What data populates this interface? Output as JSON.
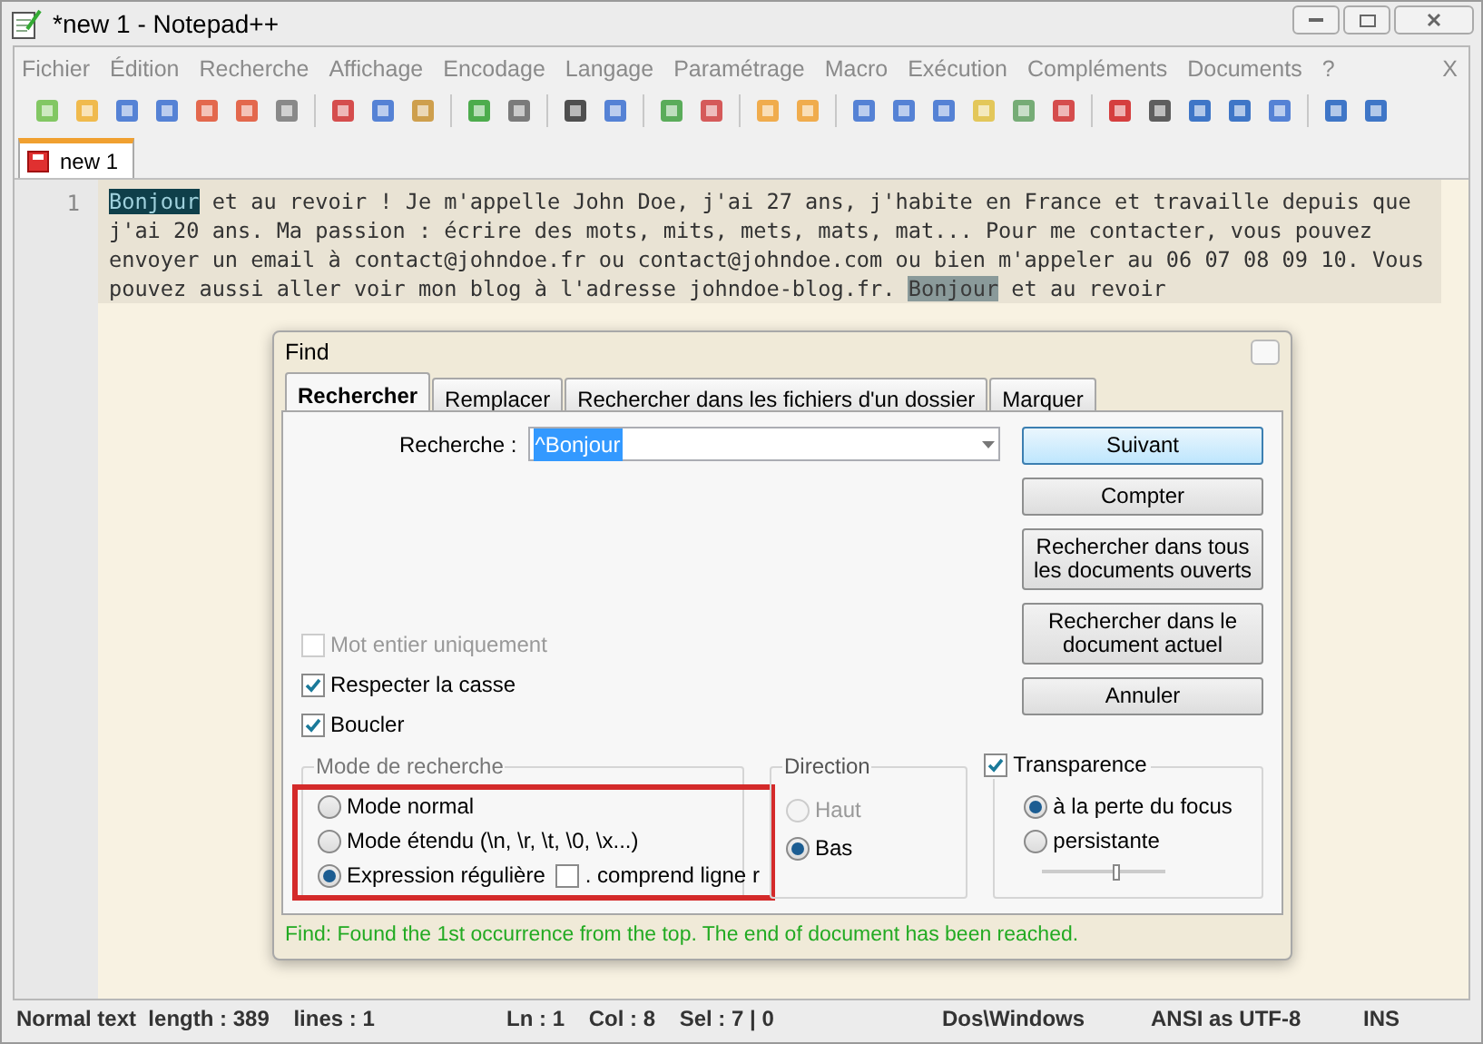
{
  "window": {
    "title": "*new  1 - Notepad++"
  },
  "menu": [
    "Fichier",
    "Édition",
    "Recherche",
    "Affichage",
    "Encodage",
    "Langage",
    "Paramétrage",
    "Macro",
    "Exécution",
    "Compléments",
    "Documents",
    "?"
  ],
  "menu_close": "X",
  "doc_tabs": [
    {
      "label": "new  1",
      "selected": true
    }
  ],
  "editor": {
    "line_number": "1",
    "segments": [
      {
        "text": "Bonjour",
        "kind": "selection"
      },
      {
        "text": " et au revoir ! Je m'appelle John Doe, j'ai 27 ans, j'habite en France et travaille depuis que j'ai 20 ans. Ma passion : écrire des mots, mits, mets, mats, mat... Pour me contacter, vous pouvez envoyer un email à contact@johndoe.fr ou contact@johndoe.com ou bien m'appeler au 06 07 08 09 10. Vous pouvez aussi aller voir mon blog à l'adresse johndoe-blog.fr. ",
        "kind": "plain"
      },
      {
        "text": "Bonjour",
        "kind": "match"
      },
      {
        "text": " et au revoir",
        "kind": "plain"
      }
    ]
  },
  "find_dialog": {
    "title": "Find",
    "tabs": [
      {
        "label": "Rechercher",
        "selected": true
      },
      {
        "label": "Remplacer",
        "selected": false
      },
      {
        "label": "Rechercher dans les fichiers d'un dossier",
        "selected": false
      },
      {
        "label": "Marquer",
        "selected": false
      }
    ],
    "search_label": "Recherche :",
    "search_value": "^Bonjour",
    "buttons": [
      {
        "label": "Suivant",
        "default": true
      },
      {
        "label": "Compter",
        "default": false
      },
      {
        "label": "Rechercher dans tous les documents ouverts",
        "default": false
      },
      {
        "label": "Rechercher dans le document actuel",
        "default": false
      },
      {
        "label": "Annuler",
        "default": false
      }
    ],
    "options": [
      {
        "label": "Mot entier uniquement",
        "checked": false,
        "disabled": true
      },
      {
        "label": "Respecter la casse",
        "checked": true,
        "disabled": false
      },
      {
        "label": "Boucler",
        "checked": true,
        "disabled": false
      }
    ],
    "mode": {
      "title": "Mode de recherche",
      "items": [
        {
          "label": "Mode normal",
          "selected": false
        },
        {
          "label": "Mode étendu (\\n, \\r, \\t, \\0, \\x...)",
          "selected": false
        },
        {
          "label": "Expression régulière",
          "selected": true
        }
      ],
      "dot_newline": {
        "label": ". comprend ligne r",
        "checked": false
      },
      "highlighted": true
    },
    "direction": {
      "title": "Direction",
      "items": [
        {
          "label": "Haut",
          "selected": false,
          "disabled": true
        },
        {
          "label": "Bas",
          "selected": true,
          "disabled": false
        }
      ]
    },
    "transparency": {
      "label": "Transparence",
      "checked": true,
      "items": [
        {
          "label": "à la perte du focus",
          "selected": true
        },
        {
          "label": "persistante",
          "selected": false
        }
      ],
      "level": 0.6
    },
    "status": "Find: Found the 1st occurrence from the top. The end of document has been reached."
  },
  "status_bar": [
    "Normal text  length : 389    lines : 1",
    "Ln : 1    Col : 8    Sel : 7 | 0",
    "Dos\\Windows",
    "ANSI as UTF-8",
    "INS"
  ]
}
